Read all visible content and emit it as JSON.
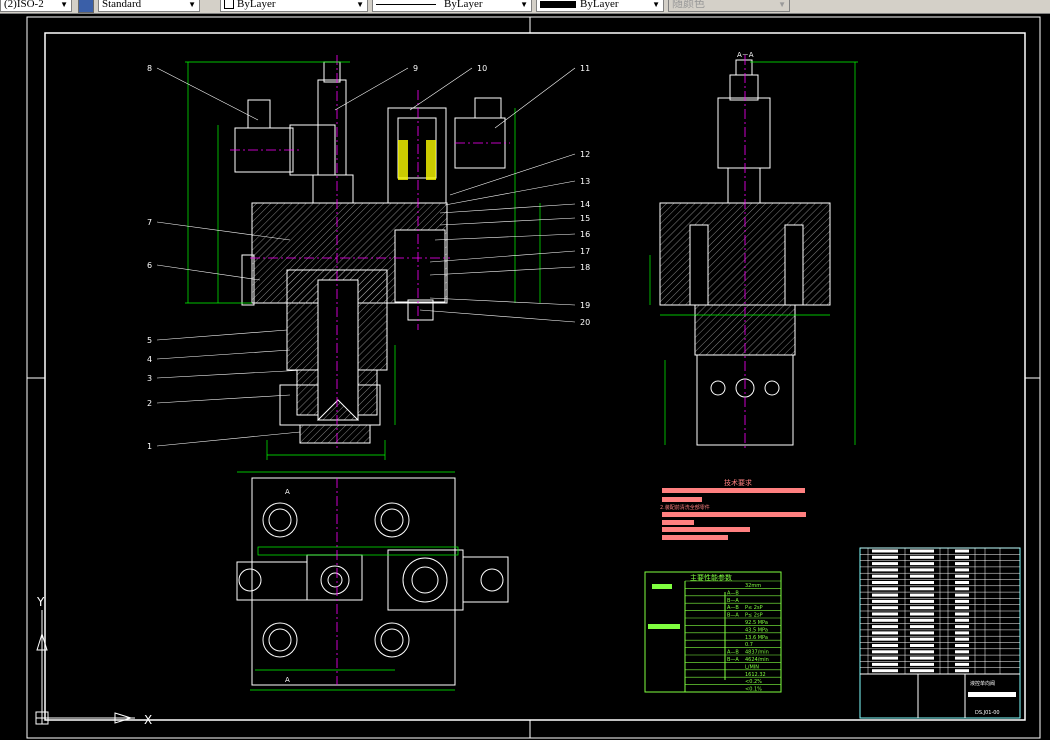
{
  "toolbar": {
    "dimstyle": "(2)ISO-2",
    "textstyle": "Standard",
    "layer": "ByLayer",
    "linetype": "ByLayer",
    "lineweight": "ByLayer",
    "plotstyle": "随颜色"
  },
  "drawing": {
    "section_label": "A－A",
    "view_mark_a": "A",
    "balloons": [
      "1",
      "2",
      "3",
      "4",
      "5",
      "6",
      "7",
      "8",
      "9",
      "10",
      "11",
      "12",
      "13",
      "14",
      "15",
      "16",
      "17",
      "18",
      "19",
      "20"
    ],
    "tech_req_title": "技术要求",
    "tech_req_line2": "2.装配前清洗全部零件",
    "perf_table": {
      "title": "主要性能参数",
      "rows": [
        [
          "",
          "32mm"
        ],
        [
          "A—B",
          ""
        ],
        [
          "B—A",
          ""
        ],
        [
          "A—B",
          "P≤ 2sP"
        ],
        [
          "B—A",
          "P≤ 2sP"
        ],
        [
          "",
          "92.5 MPa"
        ],
        [
          "",
          "43.5 MPa"
        ],
        [
          "",
          "13.6 MPa"
        ],
        [
          "",
          "0.7"
        ],
        [
          "A—B",
          "4837/min"
        ],
        [
          "B—A",
          "4624/min"
        ],
        [
          "",
          "L/MIN"
        ],
        [
          "",
          "1612.32"
        ],
        [
          "",
          "<0.2%"
        ],
        [
          "",
          "<0.1%"
        ]
      ]
    },
    "title_block": {
      "name": "液控单向阀",
      "code": "DS.J01-00"
    },
    "ucs": {
      "x": "X",
      "y": "Y"
    }
  },
  "colors": {
    "background": "#000000",
    "outline": "#ffffff",
    "dimension": "#00ff00",
    "center": "#ff00ff",
    "coil": "#ffff00",
    "text_highlight": "#ff8080",
    "table": "#80ff40",
    "titleblock": "#80ffff"
  }
}
